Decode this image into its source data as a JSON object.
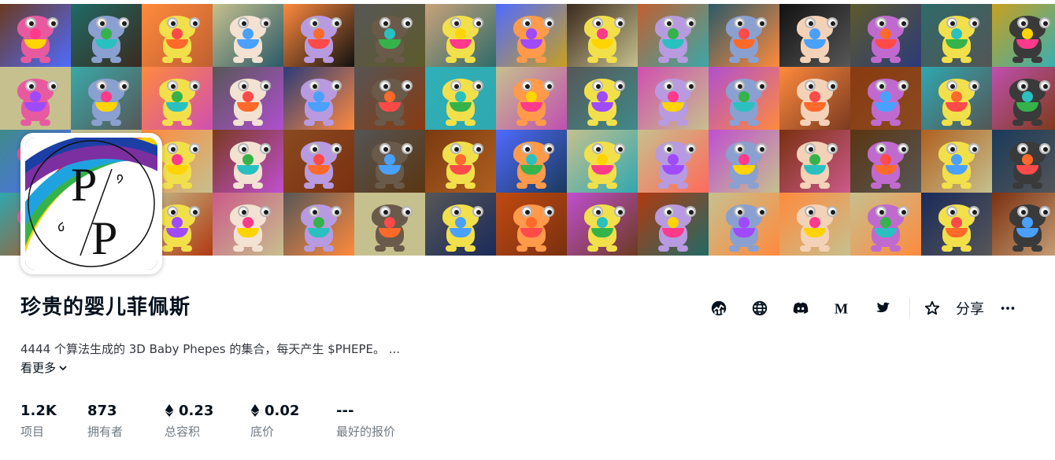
{
  "collection": {
    "title": "珍贵的婴儿菲佩斯",
    "avatar_monogram": "PP",
    "description": "4444 个算法生成的 3D Baby Phepes 的集合，每天产生 $PHEPE。 ...",
    "see_more_label": "看更多"
  },
  "actions": {
    "icons": [
      "activity-icon",
      "website-icon",
      "discord-icon",
      "medium-icon",
      "twitter-icon",
      "star-icon"
    ],
    "share_label": "分享"
  },
  "stats": [
    {
      "value": "1.2K",
      "label": "项目",
      "currency_icon": false
    },
    {
      "value": "873",
      "label": "拥有者",
      "currency_icon": false
    },
    {
      "value": "0.23",
      "label": "总容积",
      "currency_icon": true
    },
    {
      "value": "0.02",
      "label": "底价",
      "currency_icon": true
    },
    {
      "value": "---",
      "label": "最好的报价",
      "currency_icon": false
    }
  ],
  "colors": {
    "text_primary": "#04111d",
    "text_secondary": "#707a83",
    "rainbow": [
      "#e8242c",
      "#f57d20",
      "#ffd400",
      "#35b34a",
      "#1fa3e0",
      "#1c3fa6",
      "#7b2fa0"
    ]
  }
}
